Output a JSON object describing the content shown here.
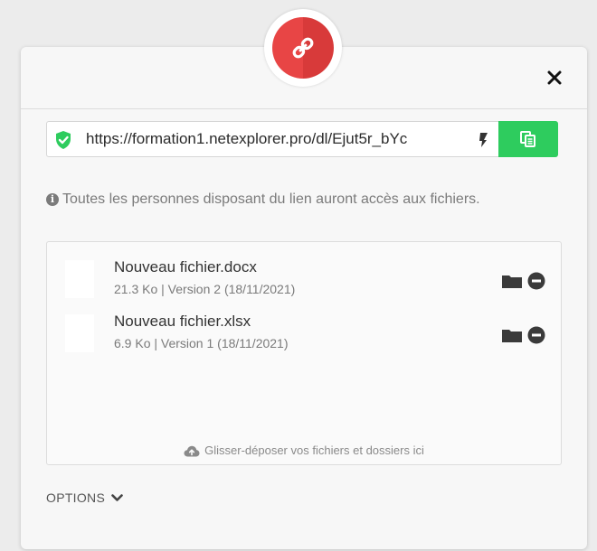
{
  "dialog": {
    "header_icon": "link-icon",
    "close_icon": "close-icon",
    "accent_color": "#e84545"
  },
  "share_link": {
    "url": "https://formation1.netexplorer.pro/dl/Ejut5r_bYc",
    "secure_icon": "shield-check-icon",
    "regenerate_icon": "refresh-icon",
    "copy_icon": "copy-icon",
    "copy_color": "#2ecc5e"
  },
  "info": {
    "icon": "info-icon",
    "text": "Toutes les personnes disposant du lien auront accès aux fichiers."
  },
  "files": [
    {
      "name": "Nouveau fichier.docx",
      "meta": "21.3 Ko | Version 2 (18/11/2021)"
    },
    {
      "name": "Nouveau fichier.xlsx",
      "meta": "6.9 Ko | Version 1 (18/11/2021)"
    }
  ],
  "drop_zone": {
    "icon": "cloud-upload-icon",
    "text": "Glisser-déposer vos fichiers et dossiers ici"
  },
  "options": {
    "label": "OPTIONS",
    "icon": "chevron-down-icon"
  }
}
